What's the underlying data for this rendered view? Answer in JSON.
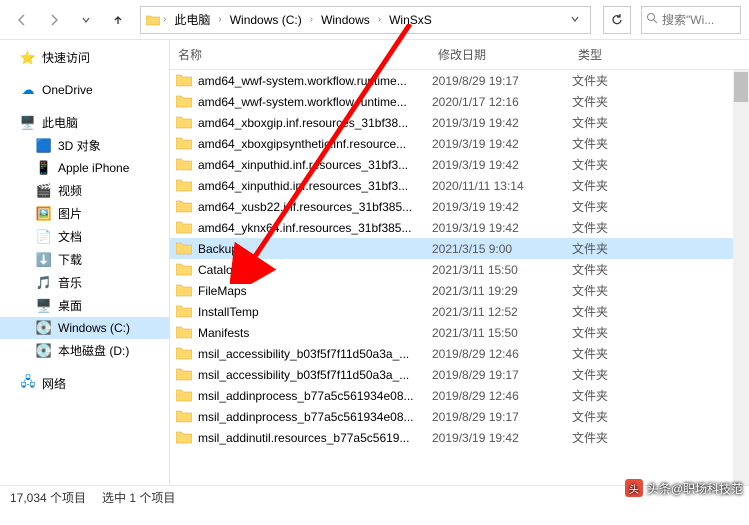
{
  "breadcrumb": {
    "items": [
      "此电脑",
      "Windows (C:)",
      "Windows",
      "WinSxS"
    ]
  },
  "search": {
    "placeholder": "搜索\"Wi..."
  },
  "sidebar": {
    "quick_access": "快速访问",
    "onedrive": "OneDrive",
    "this_pc": "此电脑",
    "children": [
      {
        "label": "3D 对象",
        "icon": "🟦"
      },
      {
        "label": "Apple iPhone",
        "icon": "📱"
      },
      {
        "label": "视频",
        "icon": "🎬"
      },
      {
        "label": "图片",
        "icon": "🖼️"
      },
      {
        "label": "文档",
        "icon": "📄"
      },
      {
        "label": "下载",
        "icon": "⬇️"
      },
      {
        "label": "音乐",
        "icon": "🎵"
      },
      {
        "label": "桌面",
        "icon": "🖥️"
      },
      {
        "label": "Windows (C:)",
        "icon": "💽",
        "selected": true
      },
      {
        "label": "本地磁盘 (D:)",
        "icon": "💽"
      }
    ],
    "network": "网络"
  },
  "columns": {
    "name": "名称",
    "date": "修改日期",
    "type": "类型"
  },
  "type_folder": "文件夹",
  "files": [
    {
      "name": "amd64_wwf-system.workflow.runtime...",
      "date": "2019/8/29 19:17"
    },
    {
      "name": "amd64_wwf-system.workflow.runtime...",
      "date": "2020/1/17 12:16"
    },
    {
      "name": "amd64_xboxgip.inf.resources_31bf38...",
      "date": "2019/3/19 19:42"
    },
    {
      "name": "amd64_xboxgipsynthetic.inf.resource...",
      "date": "2019/3/19 19:42"
    },
    {
      "name": "amd64_xinputhid.inf.resources_31bf3...",
      "date": "2019/3/19 19:42"
    },
    {
      "name": "amd64_xinputhid.inf.resources_31bf3...",
      "date": "2020/11/11 13:14"
    },
    {
      "name": "amd64_xusb22.inf.resources_31bf385...",
      "date": "2019/3/19 19:42"
    },
    {
      "name": "amd64_yknx64.inf.resources_31bf385...",
      "date": "2019/3/19 19:42"
    },
    {
      "name": "Backup",
      "date": "2021/3/15 9:00",
      "selected": true
    },
    {
      "name": "Catalogs",
      "date": "2021/3/11 15:50"
    },
    {
      "name": "FileMaps",
      "date": "2021/3/11 19:29"
    },
    {
      "name": "InstallTemp",
      "date": "2021/3/11 12:52"
    },
    {
      "name": "Manifests",
      "date": "2021/3/11 15:50"
    },
    {
      "name": "msil_accessibility_b03f5f7f11d50a3a_...",
      "date": "2019/8/29 12:46"
    },
    {
      "name": "msil_accessibility_b03f5f7f11d50a3a_...",
      "date": "2019/8/29 19:17"
    },
    {
      "name": "msil_addinprocess_b77a5c561934e08...",
      "date": "2019/8/29 12:46"
    },
    {
      "name": "msil_addinprocess_b77a5c561934e08...",
      "date": "2019/8/29 19:17"
    },
    {
      "name": "msil_addinutil.resources_b77a5c5619...",
      "date": "2019/3/19 19:42"
    }
  ],
  "status": {
    "total": "17,034 个项目",
    "selected": "选中 1 个项目"
  },
  "watermark": "头条@职场科技范"
}
